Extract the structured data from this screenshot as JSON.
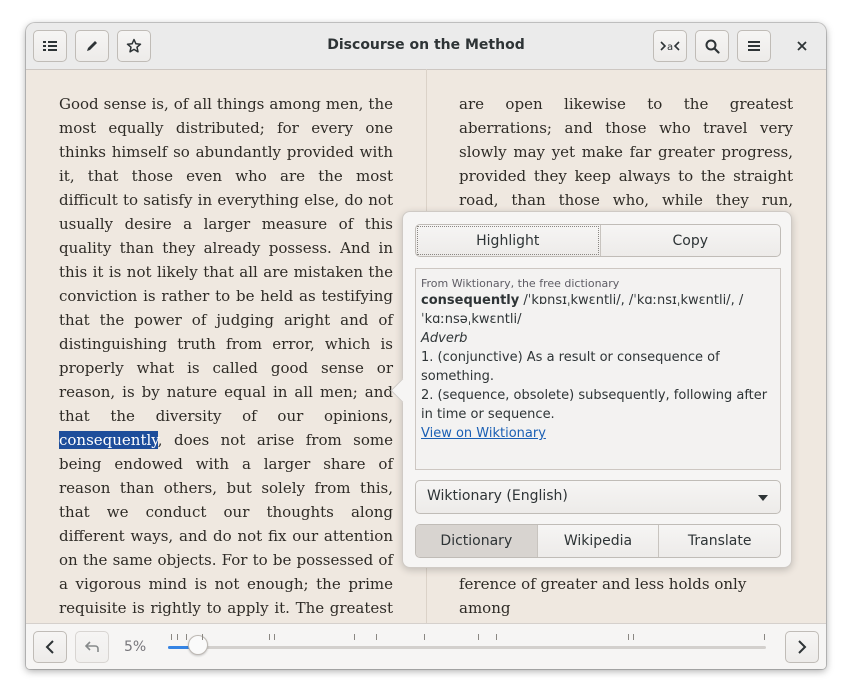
{
  "window": {
    "title": "Discourse on the Method"
  },
  "header": {
    "left_buttons": [
      "sidebar-icon",
      "pencil-icon",
      "star-icon"
    ],
    "right_buttons": [
      "read-aloud-icon",
      "search-icon",
      "menu-icon"
    ],
    "close": "close-icon"
  },
  "page_left": {
    "before": "Good sense is, of all things among men, the most equally distributed; for every one thinks himself so abundantly provided with it, that those even who are the most difficult to sat­isfy in everything else, do not usually desire a larger measure of this quality than they already possess. And in this it is not likely that all are mistaken the conviction is rather to be held as testifying that the power of judging aright and of distinguishing truth from error, which is properly what is called good sense or reason, is by nature equal in all men; and that the diversity of our opinions, ",
    "selected": "consequently",
    "after": ", does not arise from some being endowed with a larger share of reason than others, but solely from this, that we conduct our thoughts along different ways, and do not fix our attention on the same objects. For to be possessed of a vig­orous mind is not enough; the prime requisite is rightly to apply it. The greatest minds, as they are capable of the highest excellences,"
  },
  "page_right": {
    "top": "are open likewise to the greatest aberrations; and those who travel very slowly may yet make far greater progress, provided they keep always to the straight road, than those who, while they run, forsake it.",
    "bottom": "ference of greater and less holds only among"
  },
  "popover": {
    "highlight_label": "Highlight",
    "copy_label": "Copy",
    "dict_source": "From Wiktionary, the free dictionary",
    "dict_word": "consequently",
    "dict_pron": " /ˈkɒnsɪˌkwɛntli/, /ˈkɑːnsɪˌkwɛntli/, /ˈkɑːnsəˌkwɛntli/",
    "dict_pos": "Adverb",
    "dict_def1": "1. (conjunctive) As a result or consequence of something.",
    "dict_def2": "2. (sequence, obsolete) subsequently, following after in time or sequence.",
    "dict_link": "View on Wiktionary",
    "source_select": "Wiktionary (English)",
    "tabs": [
      "Dictionary",
      "Wikipedia",
      "Translate"
    ],
    "active_tab": "Dictionary"
  },
  "footer": {
    "progress_label": "5%",
    "progress": 0.05
  },
  "colors": {
    "selection": "#1e4e9b",
    "accent": "#3584e4",
    "page_bg": "#efe8e0"
  }
}
